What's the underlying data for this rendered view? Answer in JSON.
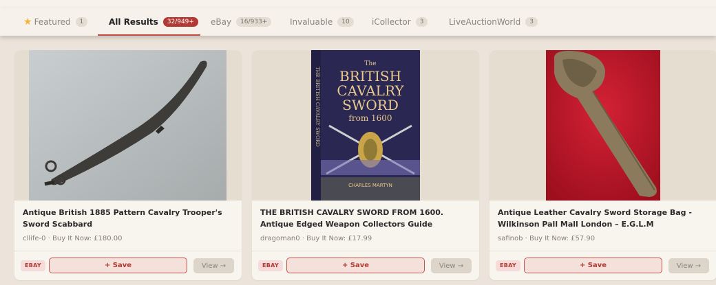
{
  "tabs": [
    {
      "label": "Featured",
      "count": "1",
      "icon": "star-icon"
    },
    {
      "label": "All Results",
      "count": "32/949+",
      "active": true
    },
    {
      "label": "eBay",
      "count": "16/933+"
    },
    {
      "label": "Invaluable",
      "count": "10"
    },
    {
      "label": "iCollector",
      "count": "3"
    },
    {
      "label": "LiveAuctionWorld",
      "count": "3"
    }
  ],
  "colors": {
    "accent": "#b33a34",
    "background": "#ece4da",
    "card": "#f8f4ee"
  },
  "results": [
    {
      "title": "Antique British 1885 Pattern Cavalry Trooper's Sword Scabbard",
      "meta": "cllife-0 · Buy It Now: £180.00",
      "source": "EBAY",
      "save_label": "+ Save",
      "view_label": "View →"
    },
    {
      "title": "THE BRITISH CAVALRY SWORD FROM 1600. Antique Edged Weapon Collectors Guide",
      "meta": "dragoman0 · Buy It Now: £17.99",
      "source": "EBAY",
      "save_label": "+ Save",
      "view_label": "View →",
      "book_cover": {
        "title_lines": [
          "The",
          "BRITISH",
          "CAVALRY",
          "SWORD",
          "from 1600"
        ],
        "spine": "THE BRITISH CAVALRY SWORD",
        "author": "CHARLES MARTYN"
      }
    },
    {
      "title": "Antique Leather Cavalry Sword Storage Bag - Wilkinson Pall Mall London – E.G.L.M",
      "meta": "safinob · Buy It Now: £57.90",
      "source": "EBAY",
      "save_label": "+ Save",
      "view_label": "View →"
    }
  ]
}
